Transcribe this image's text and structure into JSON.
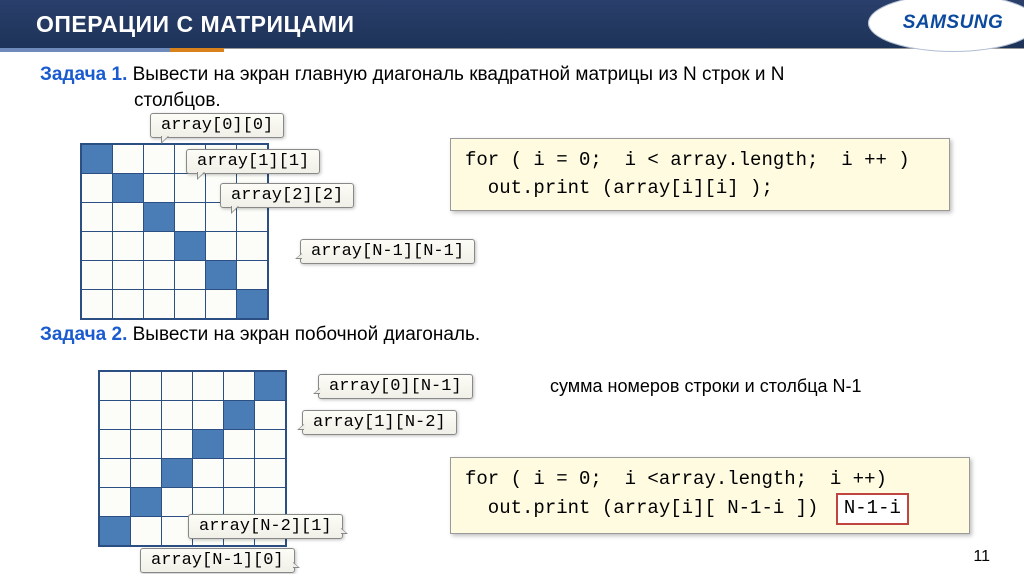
{
  "header": {
    "title": "ОПЕРАЦИИ С МАТРИЦАМИ",
    "logo": "SAMSUNG"
  },
  "task1": {
    "label": "Задача 1.",
    "text_line1": " Вывести на экран главную диагональ квадратной матрицы из N строк и N",
    "text_line2": "столбцов.",
    "callouts": {
      "c0": "array[0][0]",
      "c1": "array[1][1]",
      "c2": "array[2][2]",
      "cN": "array[N-1][N-1]"
    },
    "code": "for ( i = 0;  i < array.length;  i ++ )\n  out.print (array[i][i] );"
  },
  "task2": {
    "label": "Задача 2.",
    "text": " Вывести на экран побочной диагональ.",
    "callouts": {
      "c0": "array[0][N-1]",
      "c1": "array[1][N-2]",
      "cN2": "array[N-2][1]",
      "cN1": "array[N-1][0]"
    },
    "note": "сумма номеров строки и столбца N-1",
    "code": "for ( i = 0;  i <array.length;  i ++)\n  out.print (array[i][ N-1-i ])",
    "highlight": "N-1-i"
  },
  "page": "11"
}
